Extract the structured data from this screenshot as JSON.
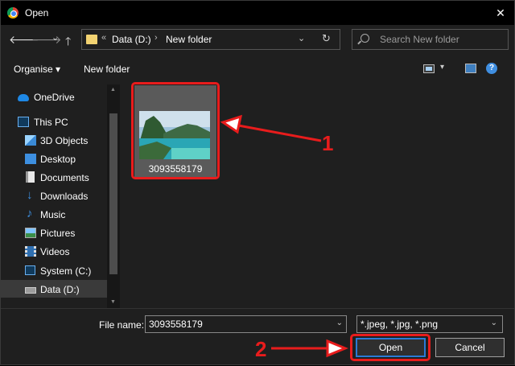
{
  "window": {
    "title": "Open",
    "close_glyph": "✕"
  },
  "nav": {
    "back": "🡐",
    "forward": "🡒",
    "recent": "⌄",
    "up": "🡑"
  },
  "address": {
    "overflow": "«",
    "crumbs": [
      "Data (D:)",
      "New folder"
    ],
    "separator": "›",
    "dropdown": "⌄",
    "refresh": "↻"
  },
  "search": {
    "placeholder": "Search New folder"
  },
  "toolbar": {
    "organise": "Organise ▾",
    "new_folder": "New folder",
    "view_dropdown": "▾",
    "help": "?"
  },
  "sidebar": {
    "items": [
      {
        "label": "OneDrive"
      },
      {
        "label": "This PC"
      },
      {
        "label": "3D Objects"
      },
      {
        "label": "Desktop"
      },
      {
        "label": "Documents"
      },
      {
        "label": "Downloads"
      },
      {
        "label": "Music"
      },
      {
        "label": "Pictures"
      },
      {
        "label": "Videos"
      },
      {
        "label": "System (C:)"
      },
      {
        "label": "Data (D:)"
      }
    ],
    "scroll_up": "▲",
    "scroll_down": "▼"
  },
  "files": [
    {
      "name": "3093558179"
    }
  ],
  "callouts": {
    "one": "1",
    "two": "2"
  },
  "footer": {
    "file_name_label": "File name:",
    "file_name_value": "3093558179",
    "file_type_value": "*.jpeg, *.jpg, *.png",
    "dropdown": "⌄",
    "open_label": "Open",
    "cancel_label": "Cancel"
  },
  "colors": {
    "annotation": "#e81c1c",
    "accent": "#2a7ad6",
    "background": "#1f1f1f"
  }
}
